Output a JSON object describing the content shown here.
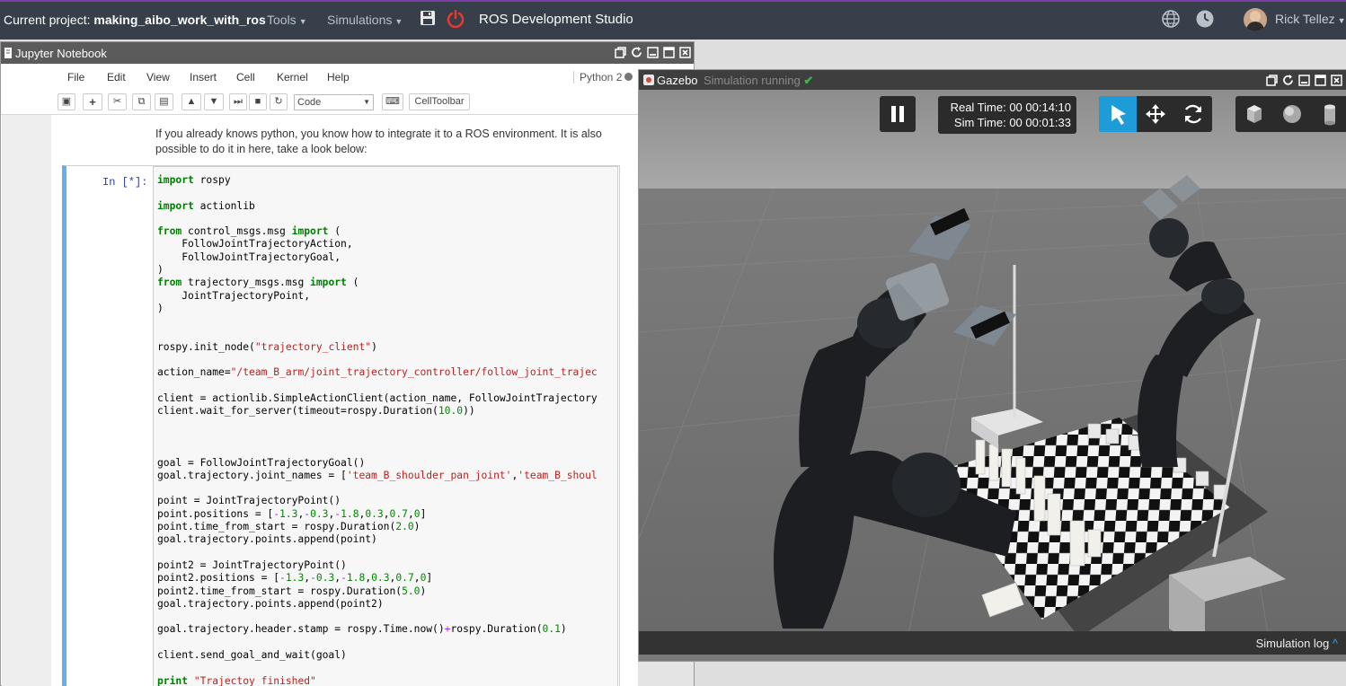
{
  "topbar": {
    "project_label": "Current project:",
    "project_name": "making_aibo_work_with_ros",
    "menu_tools": "Tools",
    "menu_simulations": "Simulations",
    "studio_title": "ROS Development Studio",
    "user_name": "Rick Tellez",
    "accent_color": "#7b3fa6"
  },
  "jupyter": {
    "window_title": "Jupyter Notebook",
    "menu": [
      "File",
      "Edit",
      "View",
      "Insert",
      "Cell",
      "Kernel",
      "Help"
    ],
    "kernel": "Python 2",
    "toolbar": {
      "cell_type": "Code",
      "celltoolbar_label": "CellToolbar"
    },
    "markdown_text": "If you already knows python, you know how to integrate it to a ROS environment. It is also possible to do it in here, take a look below:",
    "cell_prompt": "In [*]:"
  },
  "gazebo": {
    "window_title": "Gazebo",
    "status": "Simulation running",
    "real_time": "Real Time: 00 00:14:10",
    "sim_time": "Sim Time: 00 00:01:33",
    "log_label": "Simulation log",
    "active_tool_color": "#1e9cd8"
  }
}
